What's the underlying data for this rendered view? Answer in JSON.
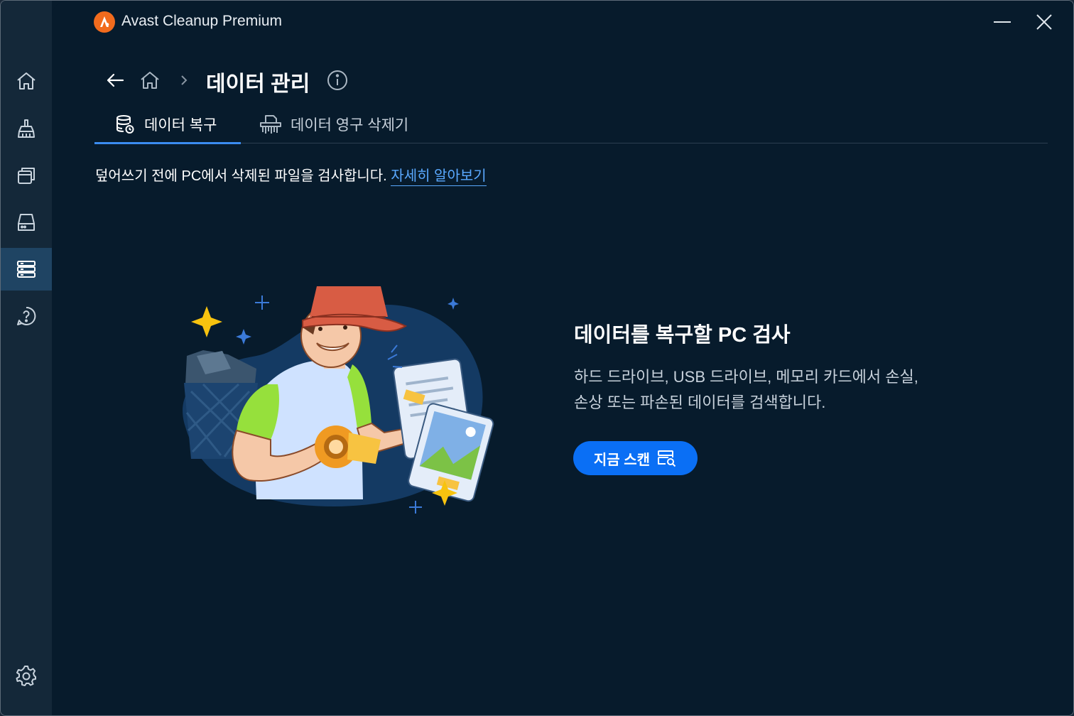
{
  "app": {
    "title": "Avast Cleanup Premium"
  },
  "sidebar": {
    "items": [
      {
        "icon": "home-icon"
      },
      {
        "icon": "broom-icon"
      },
      {
        "icon": "windows-stack-icon"
      },
      {
        "icon": "drive-icon"
      },
      {
        "icon": "data-management-icon",
        "active": true
      },
      {
        "icon": "help-icon"
      }
    ],
    "settings_icon": "gear-icon"
  },
  "header": {
    "page_title": "데이터 관리",
    "tabs": [
      {
        "label": "데이터 복구",
        "active": true
      },
      {
        "label": "데이터 영구 삭제기",
        "active": false
      }
    ]
  },
  "main": {
    "description": "덮어쓰기 전에 PC에서 삭제된 파일을 검사합니다.",
    "learn_more": "자세히 알아보기",
    "headline": "데이터를 복구할 PC 검사",
    "body_line1": "하드 드라이브, USB 드라이브, 메모리 카드에서 손실,",
    "body_line2": "손상 또는 파손된 데이터를 검색합니다.",
    "scan_button": "지금 스캔"
  },
  "colors": {
    "background": "#071b2c",
    "sidebar": "#142839",
    "accent": "#0a6ff5",
    "link": "#5aa9ff",
    "logo": "#f26b1d"
  }
}
